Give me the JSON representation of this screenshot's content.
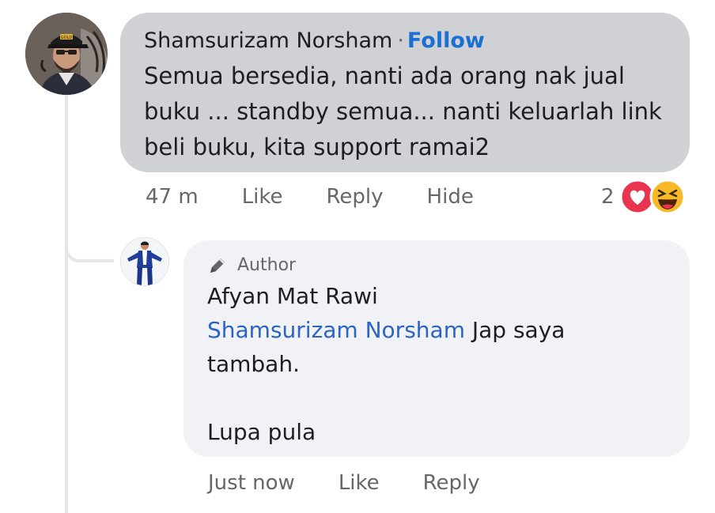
{
  "comment": {
    "author": "Shamsurizam Norsham",
    "separator": "·",
    "follow_label": "Follow",
    "text": "Semua bersedia, nanti ada orang nak jual buku ... standby semua... nanti keluarlah link beli buku, kita support ramai2",
    "time": "47 m",
    "like_label": "Like",
    "reply_label": "Reply",
    "hide_label": "Hide",
    "reaction_count": "2",
    "reactions": [
      "love-icon",
      "haha-icon"
    ],
    "avatar_cap_text": "GOLD"
  },
  "reply": {
    "badge": "Author",
    "badge_icon": "pencil-icon",
    "author": "Afyan Mat Rawi",
    "mention": "Shamsurizam Norsham",
    "text_line1": " Jap saya",
    "text_line2": "tambah.",
    "text_line3": "Lupa pula",
    "time": "Just now",
    "like_label": "Like",
    "reply_label": "Reply"
  },
  "colors": {
    "link": "#1a6fd4",
    "mention": "#2b64c2",
    "bubble_main": "#cfd1d4",
    "bubble_reply": "#f0f2f5",
    "muted_text": "#65676b",
    "love": "#e8344e",
    "haha": "#f7b928"
  }
}
